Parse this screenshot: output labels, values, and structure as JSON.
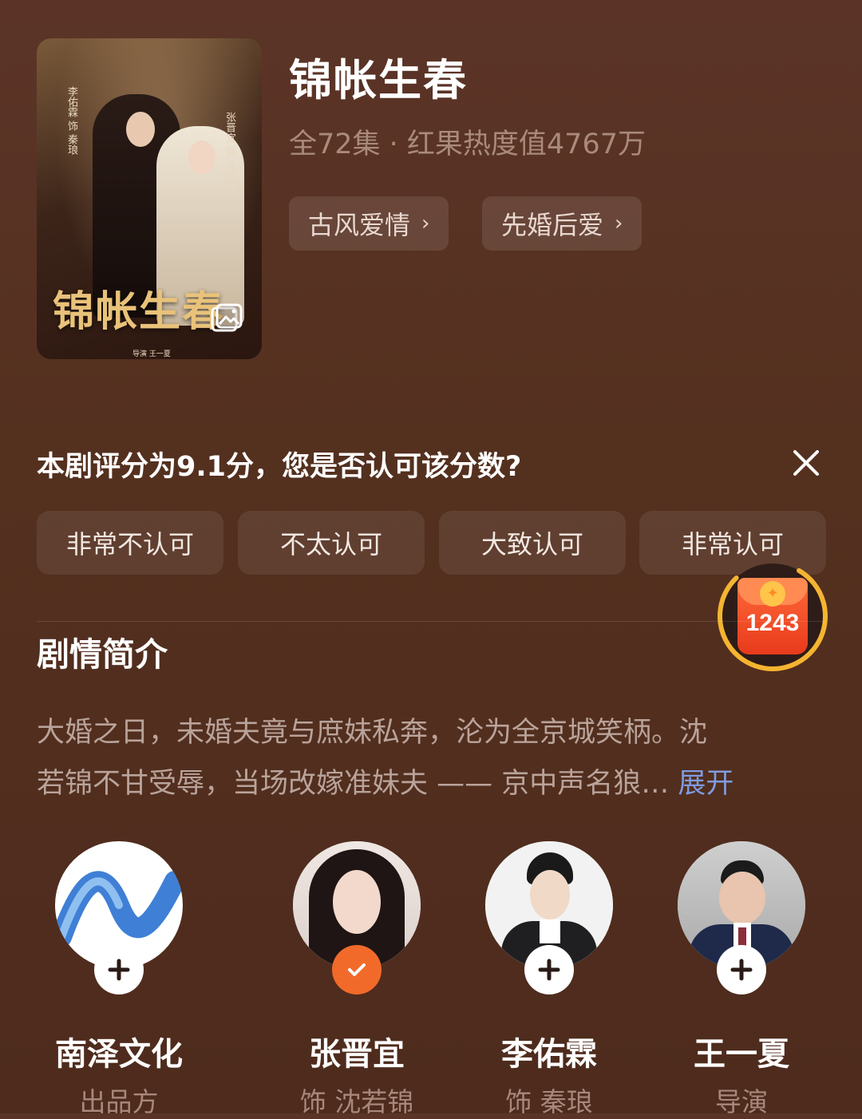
{
  "drama": {
    "title": "锦帐生春",
    "meta": "全72集 · 红果热度值4767万",
    "tags": [
      "古风爱情",
      "先婚后爱"
    ],
    "poster": {
      "title_art": "锦帐生春",
      "actor_left": "李佑霖 饰 秦琅",
      "actor_right": "张晋宜 饰 沈若锦",
      "credit": "导演 王一夏"
    }
  },
  "rating": {
    "question": "本剧评分为9.1分，您是否认可该分数?",
    "options": [
      "非常不认可",
      "不太认可",
      "大致认可",
      "非常认可"
    ]
  },
  "reward": {
    "count": "1243"
  },
  "synopsis": {
    "heading": "剧情简介",
    "line1": "大婚之日，未婚夫竟与庶妹私奔，沦为全京城笑柄。沈",
    "line2": "若锦不甘受辱，当场改嫁准妹夫 —— 京中声名狼…",
    "expand_label": "展开"
  },
  "cast": [
    {
      "name": "南泽文化",
      "role": "出品方",
      "followed": false
    },
    {
      "name": "张晋宜",
      "role": "饰 沈若锦",
      "followed": true
    },
    {
      "name": "李佑霖",
      "role": "饰 秦琅",
      "followed": false
    },
    {
      "name": "王一夏",
      "role": "导演",
      "followed": false
    }
  ],
  "icons": {
    "tag_chevron": "chevron-right-icon",
    "close": "close-icon",
    "poster_overlay": "image-icon",
    "follow": "plus-icon",
    "followed": "check-icon"
  },
  "colors": {
    "background": "#54301f",
    "accent_link": "#7f9be0",
    "followed_badge": "#f16a2a",
    "reward_ring": "#f5b431"
  }
}
